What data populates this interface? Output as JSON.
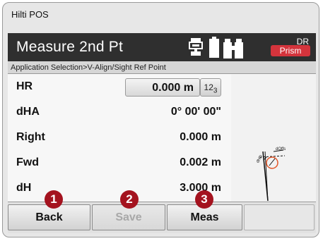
{
  "app": {
    "title": "Hilti POS"
  },
  "header": {
    "title": "Measure 2nd Pt",
    "dr_label": "DR",
    "prism_label": "Prism",
    "prism_color": "#d4343c"
  },
  "breadcrumb": "Application Selection>V-Align/Sight Ref Point",
  "rows": [
    {
      "label": "HR",
      "value": "0.000 m",
      "keypad": "123"
    },
    {
      "label": "dHA",
      "value": "0° 00' 00\""
    },
    {
      "label": "Right",
      "value": "0.000 m"
    },
    {
      "label": "Fwd",
      "value": "0.002 m"
    },
    {
      "label": "dH",
      "value": "3.000 m"
    }
  ],
  "diagram": {
    "offset_label": "dOffs",
    "height_label": "dHD",
    "target_color": "#e2572a"
  },
  "footer": {
    "back": "Back",
    "save": "Save",
    "meas": "Meas"
  },
  "markers": [
    "1",
    "2",
    "3"
  ],
  "marker_color": "#a4131f"
}
